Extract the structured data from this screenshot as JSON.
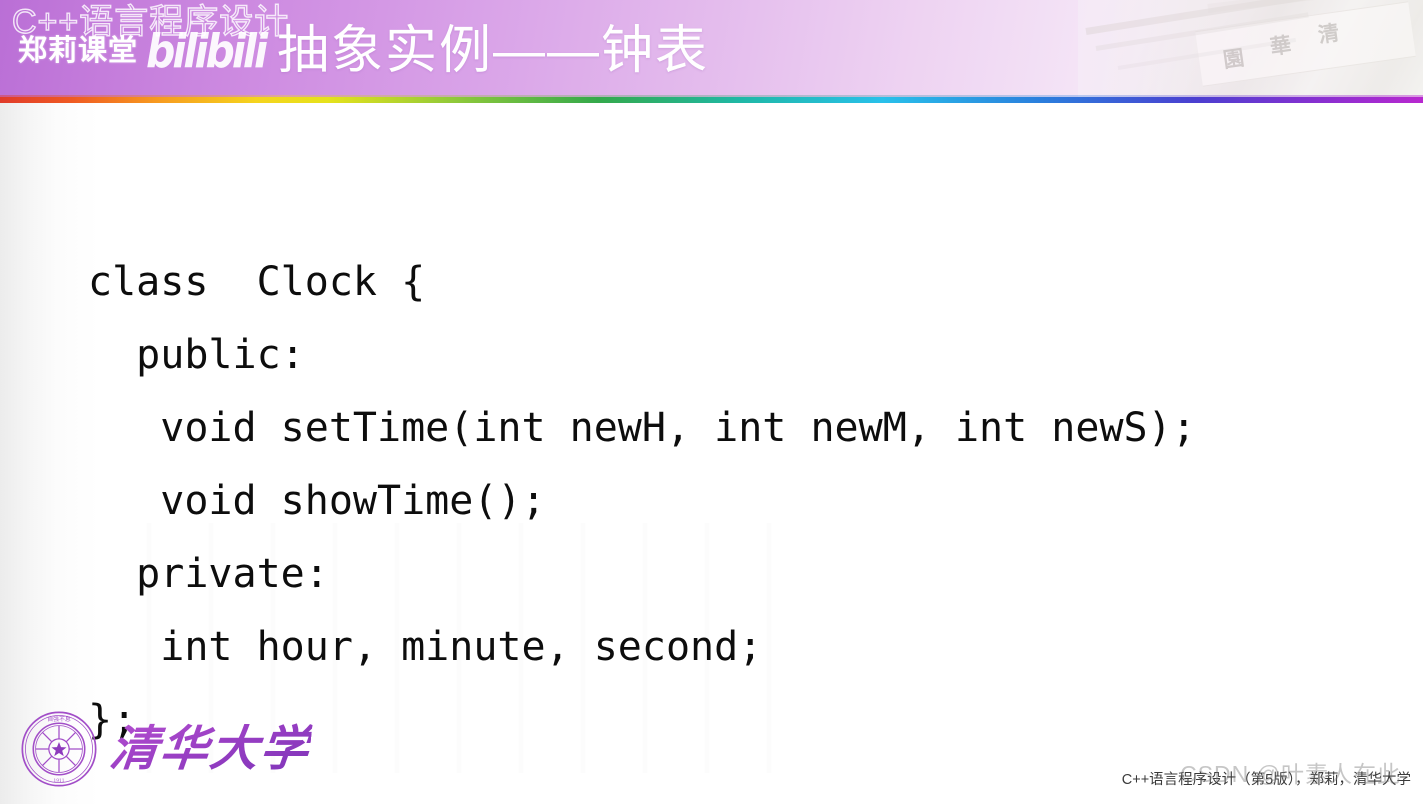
{
  "header": {
    "course_outline": "C++语言程序设计",
    "channel_name": "郑莉课堂",
    "bilibili_logo": "bilibili",
    "title": "抽象实例——钟表"
  },
  "code": {
    "lines": [
      "class  Clock {",
      "  public:",
      "   void setTime(int newH, int newM, int newS);",
      "   void showTime();",
      "  private:",
      "   int hour, minute, second;",
      "};"
    ]
  },
  "footer": {
    "university_name": "清华大学",
    "seal_glyphs": "清华大学",
    "credit": "C++语言程序设计（第5版），郑莉，清华大学",
    "watermark": "CSDN @叶素人在此"
  },
  "photo": {
    "gate_glyph_1": "清",
    "gate_glyph_2": "華",
    "gate_glyph_3": "園"
  },
  "colors": {
    "header_purple": "#ba6fd6",
    "header_fade": "#f6f2f5",
    "body_background": "#ffffff",
    "code_text": "#0d0d0d",
    "university_purple": "#9a3fc4"
  }
}
